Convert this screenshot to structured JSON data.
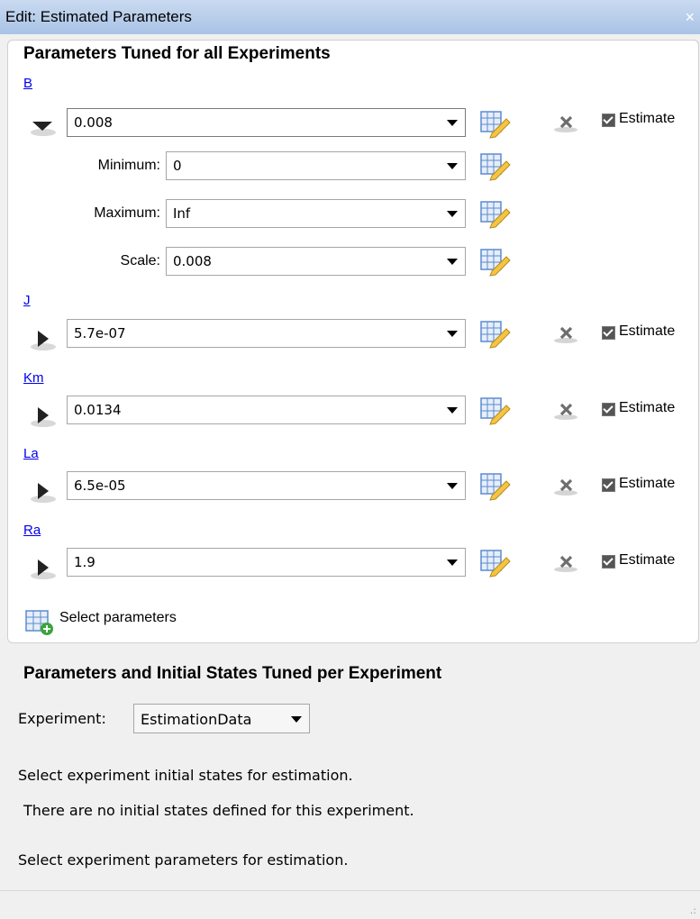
{
  "window": {
    "title": "Edit: Estimated Parameters",
    "close_glyph": "×"
  },
  "section1": {
    "title": "Parameters Tuned for all Experiments",
    "params": [
      {
        "name": "B",
        "value": "0.008",
        "expanded": true,
        "estimate_label": "Estimate"
      },
      {
        "name": "J",
        "value": "5.7e-07",
        "expanded": false,
        "estimate_label": "Estimate"
      },
      {
        "name": "Km",
        "value": "0.0134",
        "expanded": false,
        "estimate_label": "Estimate"
      },
      {
        "name": "La",
        "value": "6.5e-05",
        "expanded": false,
        "estimate_label": "Estimate"
      },
      {
        "name": "Ra",
        "value": "1.9",
        "expanded": false,
        "estimate_label": "Estimate"
      }
    ],
    "b_details": {
      "minimum_label": "Minimum:",
      "minimum_value": "0",
      "maximum_label": "Maximum:",
      "maximum_value": "Inf",
      "scale_label": "Scale:",
      "scale_value": "0.008"
    },
    "select_parameters_label": "Select parameters"
  },
  "section2": {
    "title": "Parameters and Initial States Tuned per Experiment",
    "experiment_label": "Experiment:",
    "experiment_value": "EstimationData",
    "initial_states_prompt": "Select experiment initial states for estimation.",
    "no_states_msg": "There are no initial states defined for this experiment.",
    "parameters_prompt": "Select experiment parameters for estimation."
  },
  "icons": {
    "expand": "triangle-right-icon",
    "collapse": "triangle-down-icon",
    "edit": "table-edit-icon",
    "delete": "x-delete-icon",
    "add": "table-add-icon",
    "resize": "resize-grip-icon"
  },
  "colors": {
    "link": "#0000ee",
    "titlebar": "#b4cbe9",
    "icon_yellow": "#f4c542",
    "icon_grid": "#5b8bd0"
  }
}
